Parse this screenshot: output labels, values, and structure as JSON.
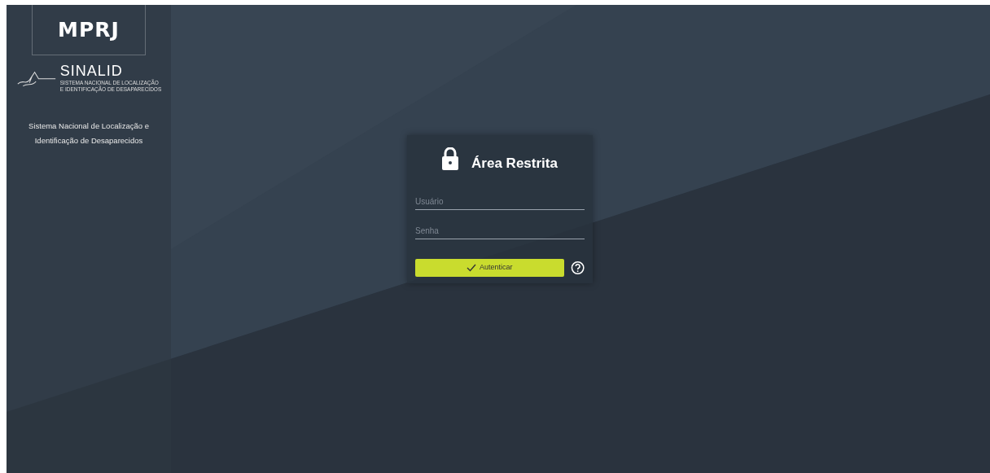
{
  "sidebar": {
    "logo": "MPRJ",
    "brand": "SINALID",
    "brand_subtitle": [
      "SISTEMA NACIONAL DE LOCALIZAÇÃO",
      "E IDENTIFICAÇÃO DE DESAPARECIDOS"
    ],
    "description": "Sistema Nacional de Localização e Identificação de Desaparecidos"
  },
  "login": {
    "title": "Área Restrita",
    "fields": [
      {
        "placeholder": "Usuário"
      },
      {
        "placeholder": "Senha"
      }
    ],
    "submit": "Autenticar"
  }
}
